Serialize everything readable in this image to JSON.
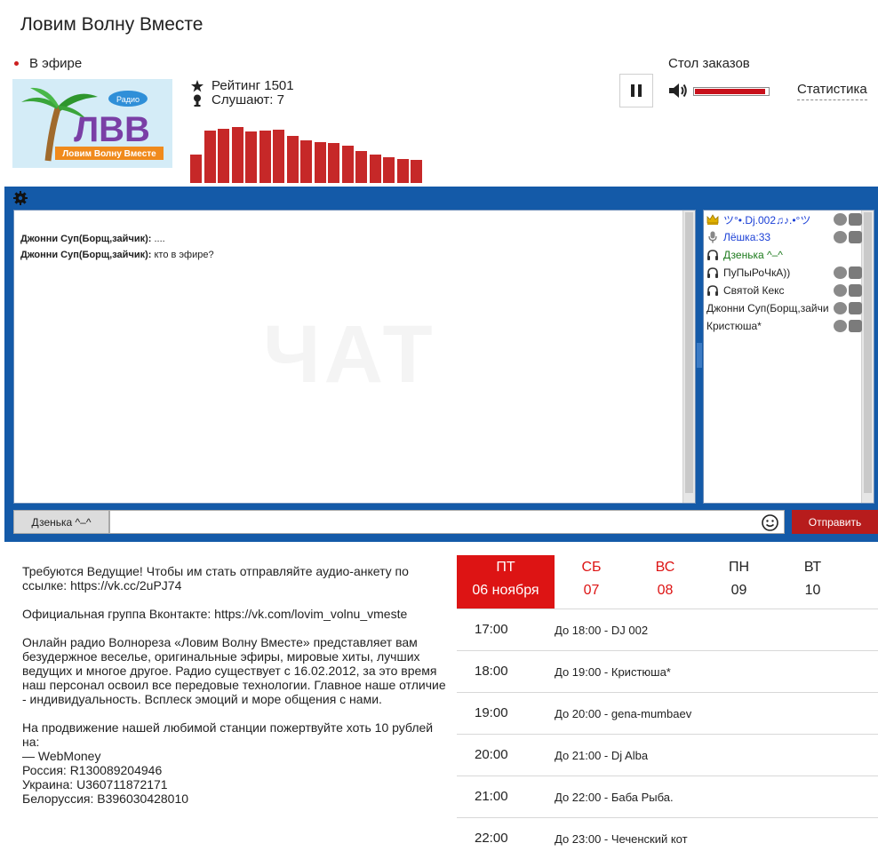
{
  "header": {
    "title": "Ловим Волну Вместе",
    "live_label": "В эфире"
  },
  "logo": {
    "badge_text": "Радио",
    "letters": "ЛВВ",
    "tagline": "Ловим Волну Вместе"
  },
  "stats": {
    "rating": "Рейтинг 1501",
    "listeners": "Слушают: 7"
  },
  "equalizer": {
    "levels": [
      0.44,
      0.82,
      0.85,
      0.88,
      0.8,
      0.82,
      0.84,
      0.74,
      0.66,
      0.64,
      0.62,
      0.58,
      0.5,
      0.44,
      0.4,
      0.38,
      0.36
    ]
  },
  "player": {
    "orders_label": "Стол заказов",
    "volume": 0.96,
    "statistics_link": "Статистика"
  },
  "chat": {
    "watermark": "ЧАТ",
    "messages": [
      {
        "author": "Джонни Суп(Борщ,зайчик):",
        "text": "...."
      },
      {
        "author": "Джонни Суп(Борщ,зайчик):",
        "text": "кто в эфире?"
      }
    ],
    "users": [
      {
        "name": "ツ°•.Dj.002♫♪.•°ツ",
        "icon": "crown-icon",
        "color": "#1a3fd6",
        "actions": true
      },
      {
        "name": "Лёшка:33",
        "icon": "microphone-icon",
        "color": "#1a3fd6",
        "actions": true
      },
      {
        "name": "Дзенька ^–^",
        "icon": "headphones-icon",
        "color": "#1c7a1c",
        "actions": false
      },
      {
        "name": "ПуПыРоЧкА))",
        "icon": "headphones-icon",
        "color": "#222222",
        "actions": true
      },
      {
        "name": "Святой Кекс",
        "icon": "headphones-icon",
        "color": "#222222",
        "actions": true
      },
      {
        "name": "Джонни Суп(Борщ,зайчик)",
        "icon": "",
        "color": "#222222",
        "actions": true
      },
      {
        "name": "Кристюша*",
        "icon": "",
        "color": "#222222",
        "actions": true
      }
    ],
    "nick_button": "Дзенька ^–^",
    "input_value": "",
    "send_button": "Отправить"
  },
  "info": {
    "p1": "Требуются Ведущие! Чтобы им стать отправляйте аудио-анкету по ссылке: https://vk.cc/2uPJ74",
    "p2": "Официальная группа Вконтакте: https://vk.com/lovim_volnu_vmeste",
    "p3": "Онлайн радио Волнореза «Ловим Волну Вместе» представляет вам безудержное веселье, оригинальные эфиры, мировые хиты, лучших ведущих и многое другое. Радио существует с 16.02.2012, за это время наш персонал освоил все передовые технологии. Главное наше отличие - индивидуальность. Всплеск эмоций и море общения с нами.",
    "p4": "На продвижение нашей любимой станции пожертвуйте хоть 10 рублей на:\n— WebMoney\nРоссия: R130089204946\nУкраина: U360711872171\nБелоруссия: B396030428010"
  },
  "schedule": {
    "days": [
      {
        "name": "ПТ",
        "date": "06 ноября",
        "type": "active"
      },
      {
        "name": "СБ",
        "date": "07",
        "type": "weekend"
      },
      {
        "name": "ВС",
        "date": "08",
        "type": "weekend"
      },
      {
        "name": "ПН",
        "date": "09",
        "type": "weekday"
      },
      {
        "name": "ВТ",
        "date": "10",
        "type": "weekday"
      }
    ],
    "slots": [
      {
        "time": "17:00",
        "desc": "До 18:00 - DJ 002"
      },
      {
        "time": "18:00",
        "desc": "До 19:00 - Кристюша*"
      },
      {
        "time": "19:00",
        "desc": "До 20:00 - gena-mumbaev"
      },
      {
        "time": "20:00",
        "desc": "До 21:00 - Dj Alba"
      },
      {
        "time": "21:00",
        "desc": "До 22:00 - Баба Рыба."
      },
      {
        "time": "22:00",
        "desc": "До 23:00 - Чеченский кот"
      }
    ]
  }
}
